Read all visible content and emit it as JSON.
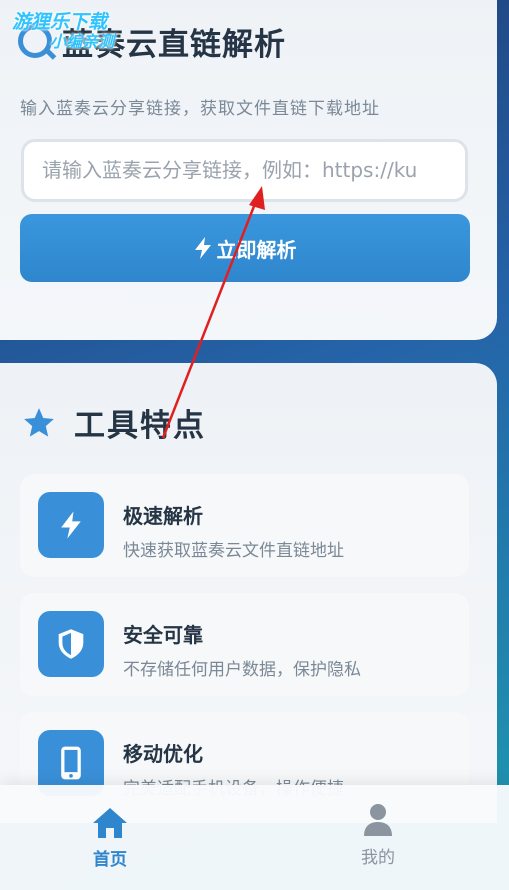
{
  "header": {
    "title": "蓝奏云直链解析",
    "watermark_line1": "游狸乐下载",
    "watermark_line2": "小编亲测",
    "subtitle": "输入蓝奏云分享链接，获取文件直链下载地址"
  },
  "parser": {
    "input_placeholder": "请输入蓝奏云分享链接，例如：https://ku",
    "parse_button_label": "立即解析"
  },
  "features": {
    "title": "工具特点",
    "items": [
      {
        "name": "极速解析",
        "desc": "快速获取蓝奏云文件直链地址",
        "icon": "bolt-icon"
      },
      {
        "name": "安全可靠",
        "desc": "不存储任何用户数据，保护隐私",
        "icon": "shield-icon"
      },
      {
        "name": "移动优化",
        "desc": "完美适配手机设备，操作便捷",
        "icon": "phone-icon"
      }
    ]
  },
  "nav": {
    "home_label": "首页",
    "me_label": "我的"
  },
  "colors": {
    "accent": "#3a90d8",
    "annotation": "#e02020"
  }
}
